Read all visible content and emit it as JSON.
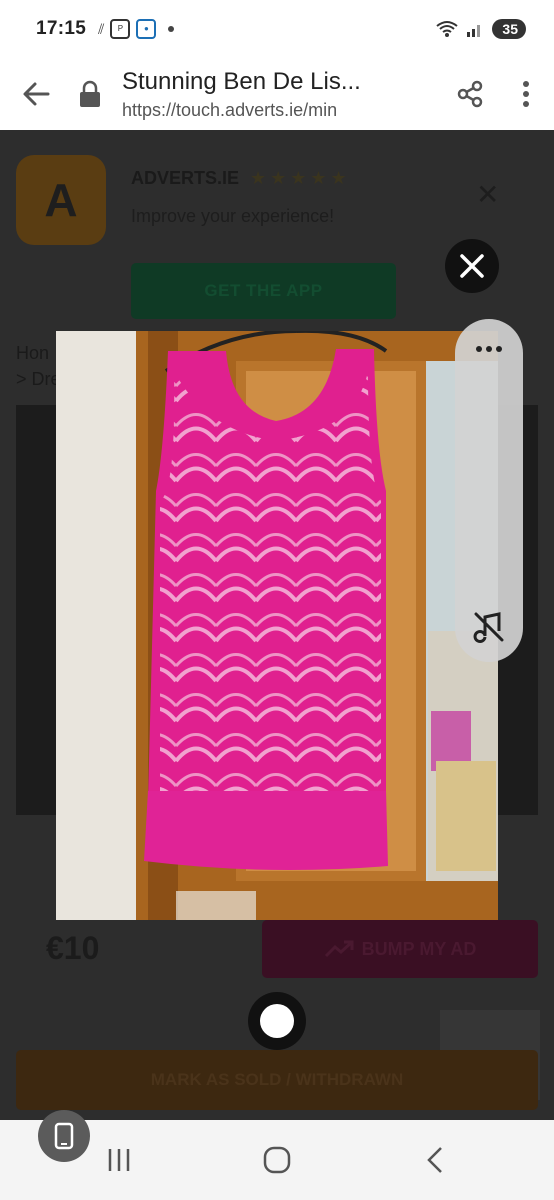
{
  "status_bar": {
    "time": "17:15",
    "battery": "35",
    "icons": [
      "signal-icon",
      "plus-app-icon",
      "chat-app-icon"
    ]
  },
  "browser": {
    "page_title": "Stunning Ben De Lis...",
    "url": "https://touch.adverts.ie/min"
  },
  "app_banner": {
    "name": "ADVERTS.IE",
    "stars": "★★★★★",
    "tagline": "Improve your experience!",
    "cta": "GET THE APP"
  },
  "breadcrumb": {
    "line1": "Hon",
    "line2": "> Dre"
  },
  "listing": {
    "price": "€10",
    "bump_label": "BUMP MY AD",
    "mark_sold_label": "MARK AS SOLD / WITHDRAWN"
  },
  "colors": {
    "dress": "#e0208f",
    "door_wood": "#a8651f",
    "accent_green": "#0f3a25",
    "accent_pink": "#3a0f23"
  }
}
